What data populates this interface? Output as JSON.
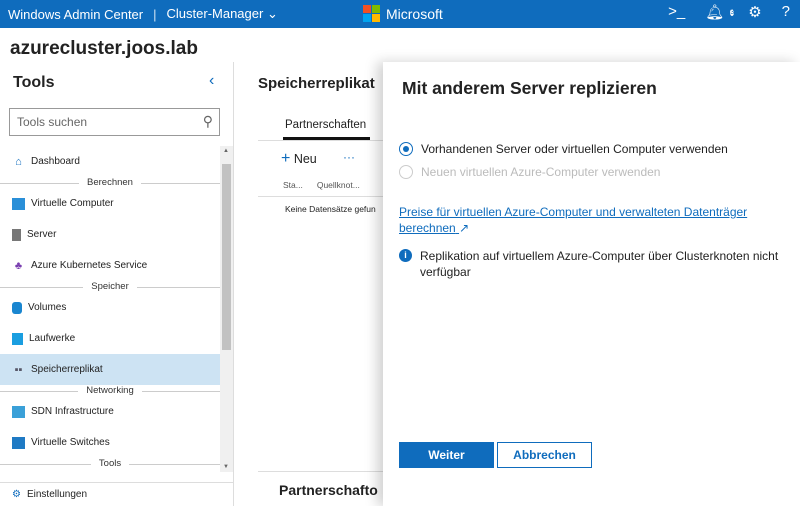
{
  "topbar": {
    "app": "Windows Admin Center",
    "context": "Cluster-Manager",
    "brand": "Microsoft",
    "notifications": "3"
  },
  "host": "azurecluster.joos.lab",
  "sidebar": {
    "title": "Tools",
    "search_placeholder": "Tools suchen",
    "items": [
      "Dashboard",
      "Virtuelle Computer",
      "Server",
      "Azure Kubernetes Service",
      "Volumes",
      "Laufwerke",
      "Speicherreplikat",
      "SDN Infrastructure",
      "Virtuelle Switches",
      "Einstellungen"
    ],
    "headers": [
      "Berechnen",
      "Speicher",
      "Networking",
      "Tools"
    ]
  },
  "main": {
    "title": "Speicherreplikat",
    "tab": "Partnerschaften",
    "new": "Neu",
    "more": "···",
    "cols": [
      "Sta...",
      "Quellknot..."
    ],
    "empty": "Keine Datensätze gefun",
    "bottom_title": "Partnerschafto"
  },
  "panel": {
    "title": "Mit anderem Server replizieren",
    "option1": "Vorhandenen Server oder virtuellen Computer verwenden",
    "option2": "Neuen virtuellen Azure-Computer verwenden",
    "link": "Preise für virtuellen Azure-Computer und verwalteten Datenträger berechnen",
    "info": "Replikation auf virtuellem Azure-Computer über Clusterknoten nicht verfügbar",
    "next": "Weiter",
    "cancel": "Abbrechen"
  }
}
